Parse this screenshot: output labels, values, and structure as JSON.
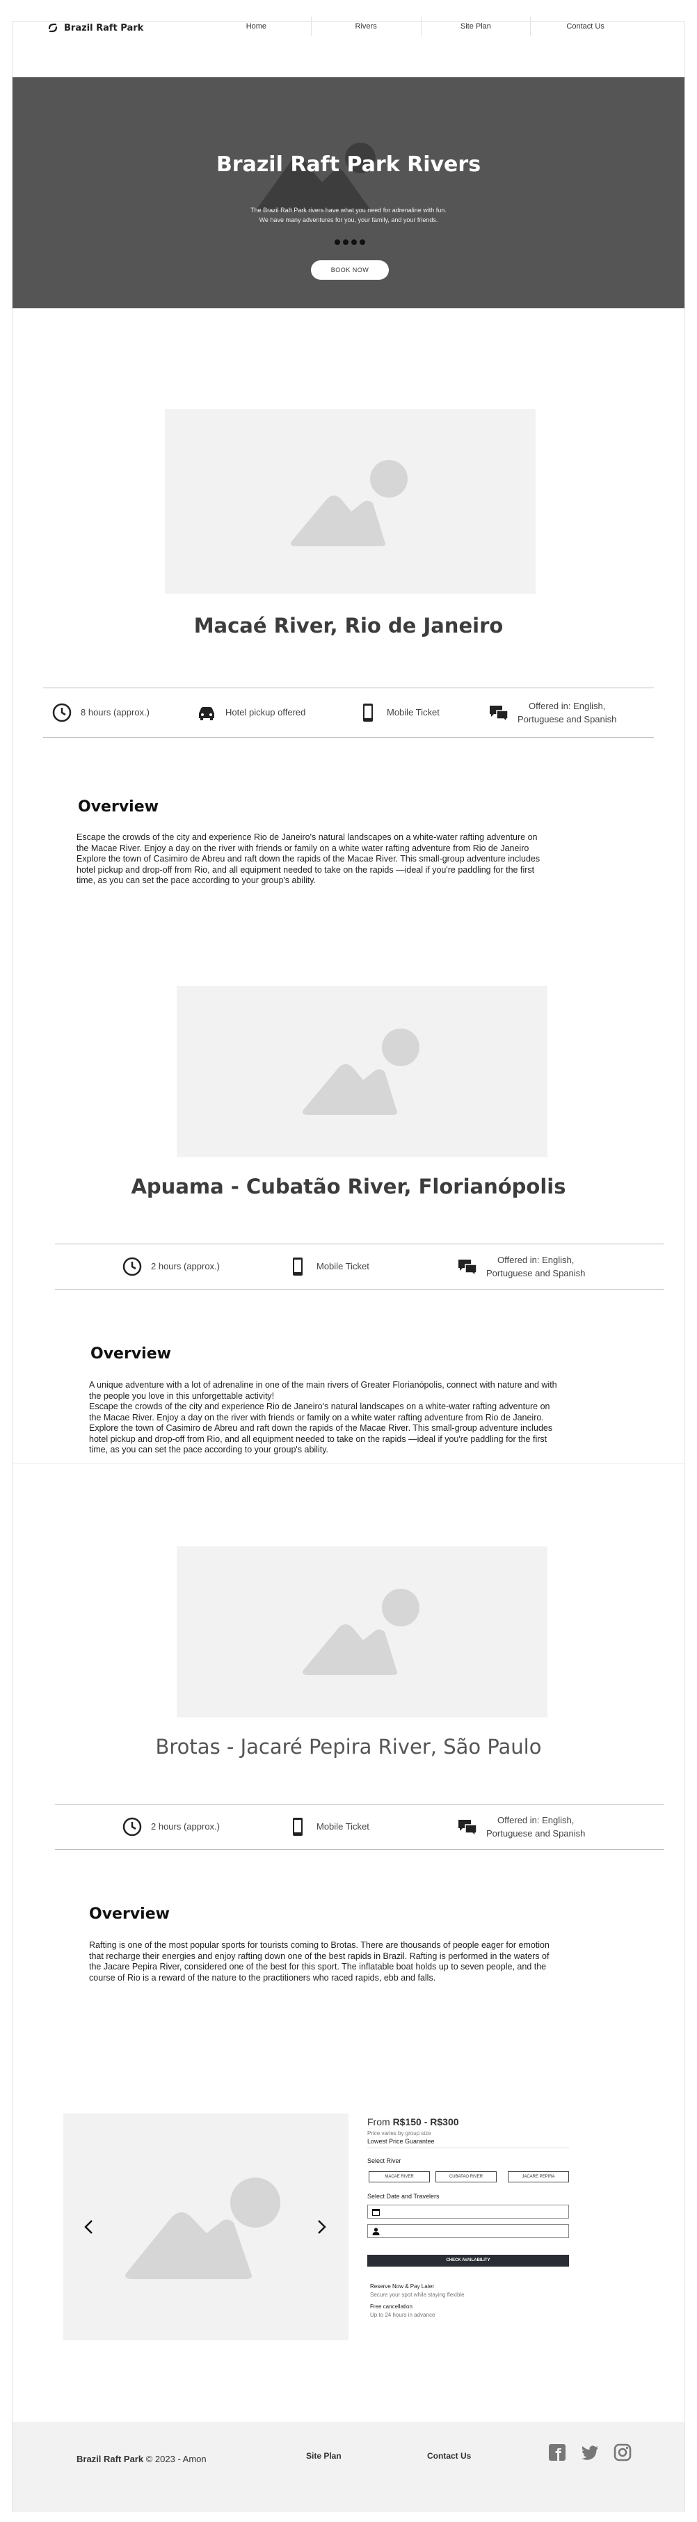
{
  "nav": {
    "brand": "Brazil Raft Park",
    "links": [
      "Home",
      "Rivers",
      "Site Plan",
      "Contact Us"
    ]
  },
  "hero": {
    "title": "Brazil Raft Park Rivers",
    "subtitle_1": "The Brazil Raft Park rivers have what you need for adrenaline with fun.",
    "subtitle_2": "We have many adventures for you, your family, and your friends.",
    "slide_count": 4,
    "book_button": "BOOK NOW"
  },
  "rivers": [
    {
      "title": "Macaé River, Rio de Janeiro",
      "info": {
        "duration": "8 hours (approx.)",
        "pickup": "Hotel pickup offered",
        "ticket": "Mobile Ticket",
        "languages_1": "Offered in: English,",
        "languages_2": "Portuguese and Spanish"
      },
      "overview_title": "Overview",
      "overview": "Escape the crowds of the city and experience Rio de Janeiro's natural landscapes on a white-water rafting adventure on\nthe Macae River. Enjoy a day on the river with friends or family on a white water rafting adventure from Rio de Janeiro\nExplore the town of Casimiro de Abreu and raft down the rapids of the Macae River. This small-group adventure includes\nhotel pickup and drop-off from Rio, and all equipment needed to take on the rapids —ideal if you're paddling for the first\ntime, as you can set the pace according to your group's ability."
    },
    {
      "title": "Apuama - Cubatão River, Florianópolis",
      "info": {
        "duration": "2 hours (approx.)",
        "ticket": "Mobile Ticket",
        "languages_1": "Offered in: English,",
        "languages_2": "Portuguese and Spanish"
      },
      "overview_title": "Overview",
      "overview": "A unique adventure with a lot of adrenaline in one of the main rivers of Greater Florianópolis, connect with nature and with\nthe people you love in this unforgettable activity!\nEscape the crowds of the city and experience Rio de Janeiro's natural landscapes on a white-water rafting adventure on\nthe Macae River. Enjoy a day on the river with friends or family on a white water rafting adventure from Rio de Janeiro.\nExplore the town of Casimiro de Abreu and raft down the rapids of the Macae River. This small-group adventure includes\nhotel pickup and drop-off from Rio, and all equipment needed to take on the rapids —ideal if you're paddling for the first\ntime, as you can set the pace according to your group's ability."
    },
    {
      "title": "Brotas - Jacaré Pepira River, São Paulo",
      "info": {
        "duration": "2 hours (approx.)",
        "ticket": "Mobile Ticket",
        "languages_1": "Offered in: English,",
        "languages_2": "Portuguese and Spanish"
      },
      "overview_title": "Overview",
      "overview": "Rafting is one of the most popular sports for tourists coming to Brotas. There are thousands of people eager for emotion\nthat recharge their energies and enjoy rafting down one of the best rapids in Brazil. Rafting is performed in the waters of\nthe Jacare Pepira River, considered one of the best for this sport. The inflatable boat holds up to seven people, and the\ncourse of Rio is a reward of the nature to the practitioners who raced rapids, ebb and falls."
    }
  ],
  "booking": {
    "price_prefix": "From",
    "price_range": "R$150 - R$300",
    "price_note": "Price varies by group size",
    "guarantee": "Lowest Price Guarantee",
    "select_river_label": "Select River",
    "river_options": [
      "MACAE RIVER",
      "CUBATAO RIVER",
      "JACARE PEPIRA"
    ],
    "date_travelers_label": "Select Date and Travelers",
    "check_button": "CHECK AVAILABILITY",
    "reserve_title": "Reserve Now & Pay Later",
    "reserve_note": "Secure your spot while staying flexible",
    "cancel_title": "Free cancellation",
    "cancel_note": "Up to 24 hours in advance"
  },
  "footer": {
    "brand": "Brazil Raft Park",
    "copyright": "© 2023 - Amon",
    "site_plan": "Site Plan",
    "contact": "Contact Us"
  },
  "colors": {
    "hero_bg": "#555555",
    "placeholder": "#f2f2f2",
    "placeholder_shape": "#d6d6d6",
    "button_dark": "#2a2d33",
    "footer_bg": "#f2f2f2"
  }
}
